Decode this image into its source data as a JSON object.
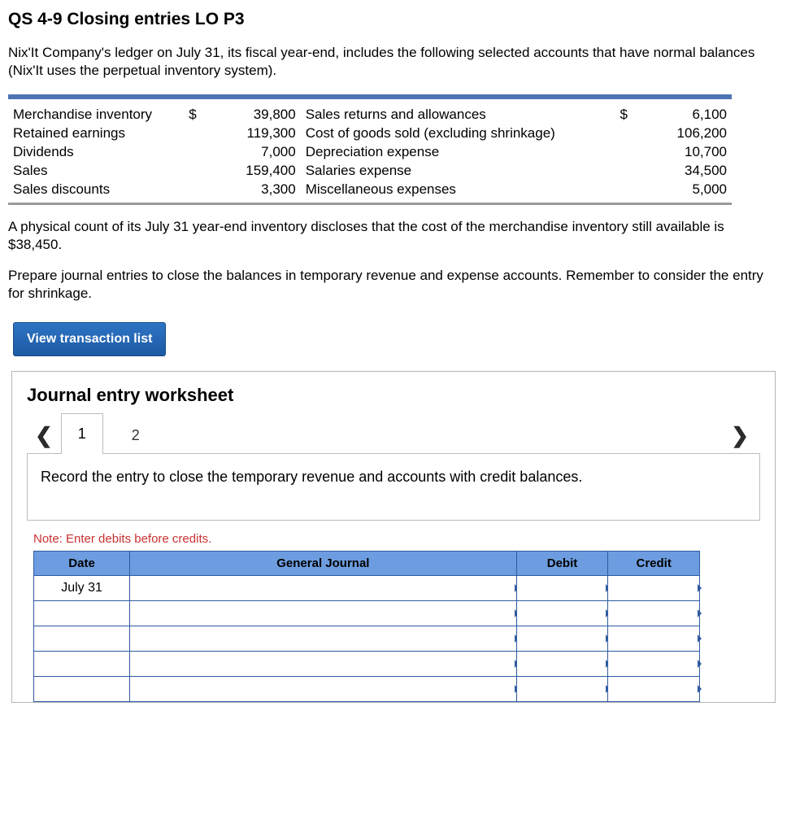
{
  "title": "QS 4-9 Closing entries LO P3",
  "intro": "Nix'It Company's ledger on July 31, its fiscal year-end, includes the following selected accounts that have normal balances (Nix'It uses the perpetual inventory system).",
  "accounts": {
    "left": [
      {
        "label": "Merchandise inventory",
        "value": "39,800",
        "prefix": "$"
      },
      {
        "label": "Retained earnings",
        "value": "119,300",
        "prefix": ""
      },
      {
        "label": "Dividends",
        "value": "7,000",
        "prefix": ""
      },
      {
        "label": "Sales",
        "value": "159,400",
        "prefix": ""
      },
      {
        "label": "Sales discounts",
        "value": "3,300",
        "prefix": ""
      }
    ],
    "right": [
      {
        "label": "Sales returns and allowances",
        "value": "6,100",
        "prefix": "$"
      },
      {
        "label": "Cost of goods sold (excluding shrinkage)",
        "value": "106,200",
        "prefix": ""
      },
      {
        "label": "Depreciation expense",
        "value": "10,700",
        "prefix": ""
      },
      {
        "label": "Salaries expense",
        "value": "34,500",
        "prefix": ""
      },
      {
        "label": "Miscellaneous expenses",
        "value": "5,000",
        "prefix": ""
      }
    ]
  },
  "physical_count": "A physical count of its July 31 year-end inventory discloses that the cost of the merchandise inventory still available is $38,450.",
  "instructions": "Prepare journal entries to close the balances in temporary revenue and expense accounts. Remember to consider the entry for shrinkage.",
  "button_view": "View transaction list",
  "worksheet": {
    "title": "Journal entry worksheet",
    "tabs": [
      "1",
      "2"
    ],
    "active_tab": 0,
    "entry_text": "Record the entry to close the temporary revenue and accounts with credit balances.",
    "note": "Note: Enter debits before credits.",
    "columns": [
      "Date",
      "General Journal",
      "Debit",
      "Credit"
    ],
    "rows": [
      {
        "date": "July 31",
        "general": "",
        "debit": "",
        "credit": ""
      },
      {
        "date": "",
        "general": "",
        "debit": "",
        "credit": ""
      },
      {
        "date": "",
        "general": "",
        "debit": "",
        "credit": ""
      },
      {
        "date": "",
        "general": "",
        "debit": "",
        "credit": ""
      },
      {
        "date": "",
        "general": "",
        "debit": "",
        "credit": ""
      }
    ]
  }
}
